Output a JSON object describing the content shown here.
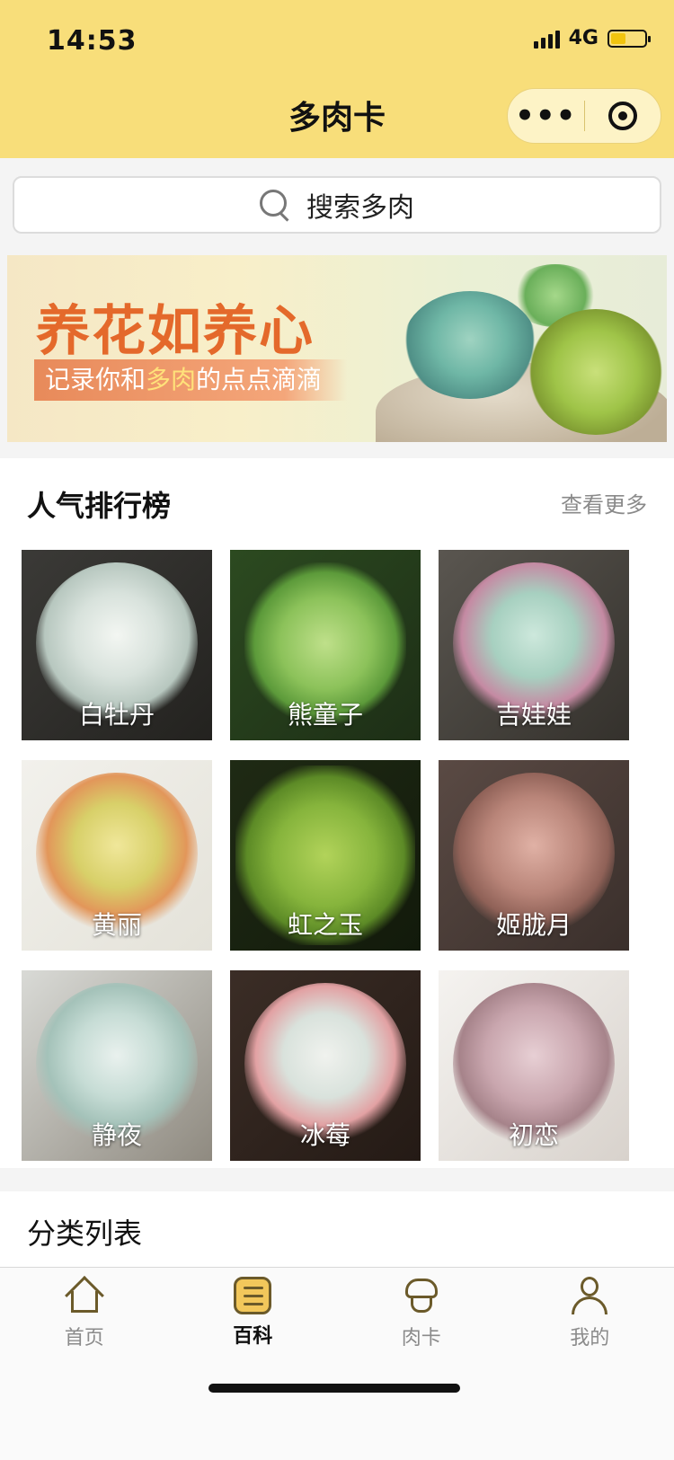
{
  "status_bar": {
    "time": "14:53",
    "network": "4G",
    "battery_level": 0.45,
    "signal_bars": 4
  },
  "nav": {
    "title": "多肉卡",
    "more_icon": "more-dots-icon",
    "target_icon": "target-icon"
  },
  "search": {
    "placeholder": "搜索多肉",
    "icon": "search-icon"
  },
  "banner": {
    "title": "养花如养心",
    "subtitle_before": "记录你和",
    "subtitle_highlight": "多肉",
    "subtitle_after": "的点点滴滴"
  },
  "ranking": {
    "title": "人气排行榜",
    "more": "查看更多",
    "items": [
      {
        "name": "白牡丹"
      },
      {
        "name": "熊童子"
      },
      {
        "name": "吉娃娃"
      },
      {
        "name": "黄丽"
      },
      {
        "name": "虹之玉"
      },
      {
        "name": "姬胧月"
      },
      {
        "name": "静夜"
      },
      {
        "name": "冰莓"
      },
      {
        "name": "初恋"
      }
    ]
  },
  "category": {
    "title": "分类列表"
  },
  "tabbar": {
    "active": "百科",
    "accent_color": "#f2c75b",
    "items": [
      {
        "label": "首页",
        "icon": "home-icon"
      },
      {
        "label": "百科",
        "icon": "encyclopedia-icon"
      },
      {
        "label": "肉卡",
        "icon": "succulent-card-icon"
      },
      {
        "label": "我的",
        "icon": "profile-icon"
      }
    ]
  }
}
